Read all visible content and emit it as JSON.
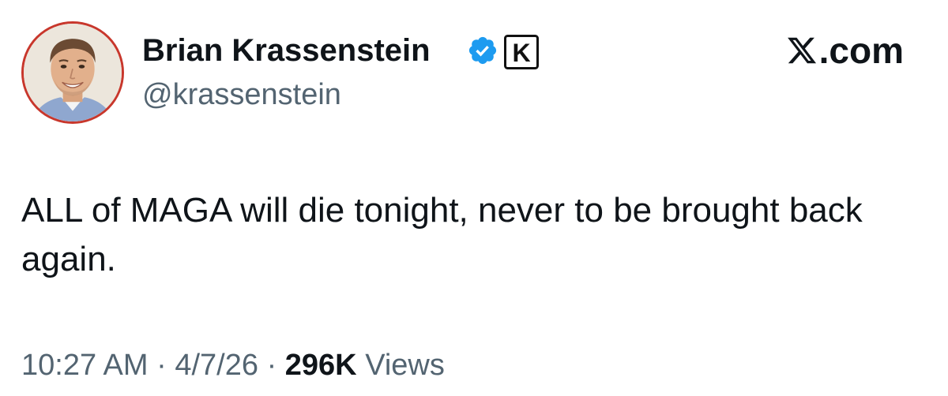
{
  "author": {
    "display_name": "Brian Krassenstein",
    "handle": "@krassenstein",
    "verified_icon": "verified-check-icon",
    "affiliate_badge": "K",
    "avatar": "profile-photo"
  },
  "site": {
    "logo_text": ".com",
    "logo_icon": "x-logo-icon"
  },
  "tweet": {
    "text": "ALL of MAGA will die tonight, never to be brought back again."
  },
  "meta": {
    "time": "10:27 AM",
    "separator": "·",
    "date": "4/7/26",
    "views_count": "296K",
    "views_label": "Views"
  },
  "colors": {
    "verified_blue": "#1d9bf0",
    "secondary_text": "#536471",
    "primary_text": "#0f1419",
    "avatar_ring": "#c8372c"
  }
}
